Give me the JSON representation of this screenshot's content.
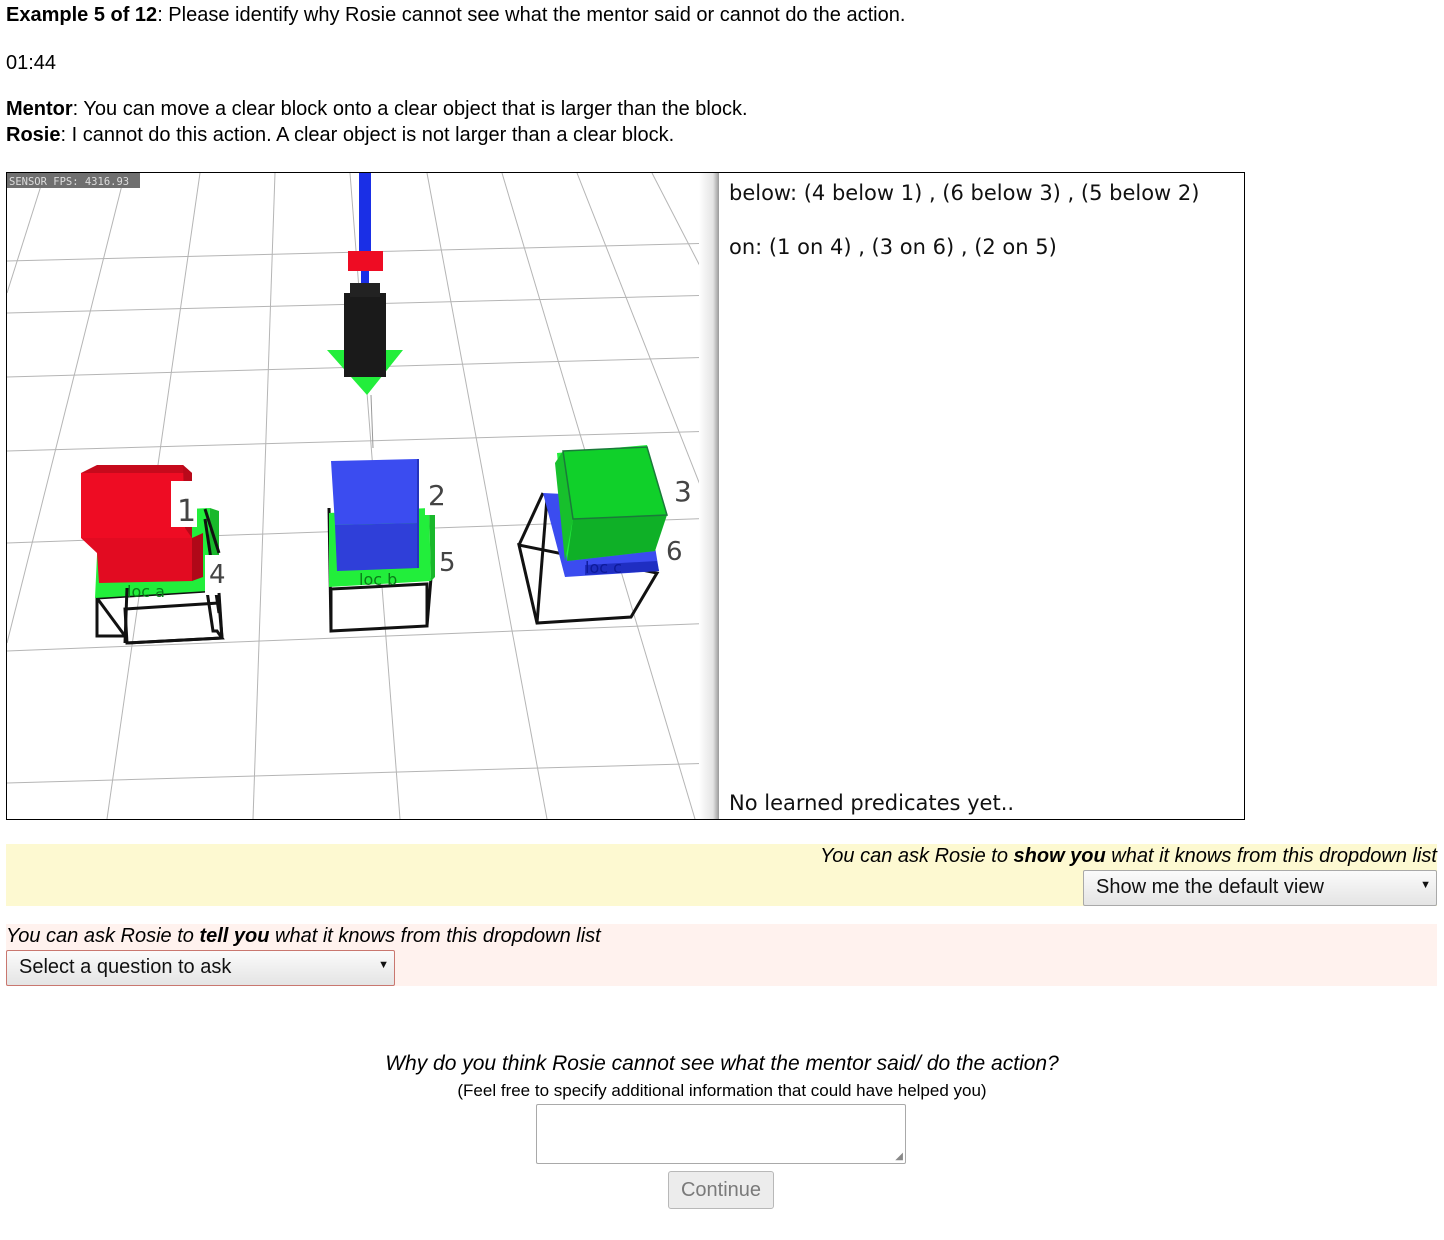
{
  "header": {
    "example_label": "Example 5 of 12",
    "instruction": ": Please identify why Rosie cannot see what the mentor said or cannot do the action."
  },
  "timer": "01:44",
  "dialog": {
    "mentor_name": "Mentor",
    "mentor_text": ": You can move a clear block onto a clear object that is larger than the block.",
    "rosie_name": "Rosie",
    "rosie_text": ": I cannot do this action. A clear object is not larger than a clear block."
  },
  "scene": {
    "fps_overlay": "SENSOR FPS: 4316.93",
    "block_numbers": [
      "1",
      "2",
      "3",
      "4",
      "5",
      "6"
    ],
    "location_labels": [
      "loc a",
      "loc b",
      "loc c"
    ],
    "colors": {
      "red": "#ee0c23",
      "blue": "#3b4cf0",
      "green": "#22ee3b",
      "arm_blue": "#1a2fe6"
    }
  },
  "knowledge": {
    "below": "below: (4 below 1) , (6 below 3) , (5 below 2)",
    "on": "on: (1 on 4) , (3 on 6) , (2 on 5)",
    "learned": "No learned predicates yet.."
  },
  "show": {
    "prompt_pre": "You can ask Rosie to ",
    "prompt_bold": "show you",
    "prompt_post": " what it knows from this dropdown list",
    "selected": "Show me the default view"
  },
  "tell": {
    "prompt_pre": "You can ask Rosie to ",
    "prompt_bold": "tell you",
    "prompt_post": " what it knows from this dropdown list",
    "selected": "Select a question to ask"
  },
  "question": {
    "text": "Why do you think Rosie cannot see what the mentor said/ do the action?",
    "hint": "(Feel free to specify additional information that could have helped you)"
  },
  "continue_label": "Continue",
  "colors": {
    "show_bg": "#fdf9d1",
    "tell_bg": "#fff2ee"
  }
}
